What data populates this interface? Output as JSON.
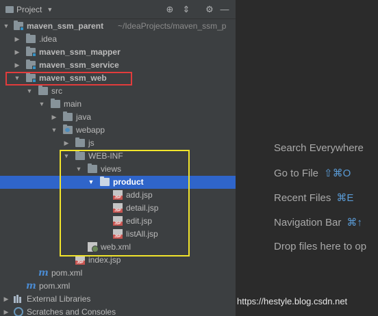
{
  "toolbar": {
    "title": "Project",
    "icons": [
      "globe-target-icon",
      "collapse-icon",
      "gear-icon",
      "hide-icon"
    ]
  },
  "tree": [
    {
      "label": "maven_ssm_parent",
      "path": "~/IdeaProjects/maven_ssm_p"
    },
    {
      "label": ".idea"
    },
    {
      "label": "maven_ssm_mapper"
    },
    {
      "label": "maven_ssm_service"
    },
    {
      "label": "maven_ssm_web"
    },
    {
      "label": "src"
    },
    {
      "label": "main"
    },
    {
      "label": "java"
    },
    {
      "label": "webapp"
    },
    {
      "label": "js"
    },
    {
      "label": "WEB-INF"
    },
    {
      "label": "views"
    },
    {
      "label": "product"
    },
    {
      "label": "add.jsp"
    },
    {
      "label": "detail.jsp"
    },
    {
      "label": "edit.jsp"
    },
    {
      "label": "listAll.jsp"
    },
    {
      "label": "web.xml"
    },
    {
      "label": "index.jsp"
    },
    {
      "label": "pom.xml"
    },
    {
      "label": "pom.xml"
    },
    {
      "label": "External Libraries"
    },
    {
      "label": "Scratches and Consoles"
    }
  ],
  "editor_hints": [
    {
      "text": "Search Everywhere",
      "shortcut": ""
    },
    {
      "text": "Go to File",
      "shortcut": "⇧⌘O"
    },
    {
      "text": "Recent Files",
      "shortcut": "⌘E"
    },
    {
      "text": "Navigation Bar",
      "shortcut": "⌘↑"
    },
    {
      "text": "Drop files here to op",
      "shortcut": ""
    }
  ],
  "watermark": "https://hestyle.blog.csdn.net",
  "colors": {
    "selection": "#2f65ca",
    "highlight_red": "#e23c3c",
    "highlight_yellow": "#f2e52b"
  }
}
